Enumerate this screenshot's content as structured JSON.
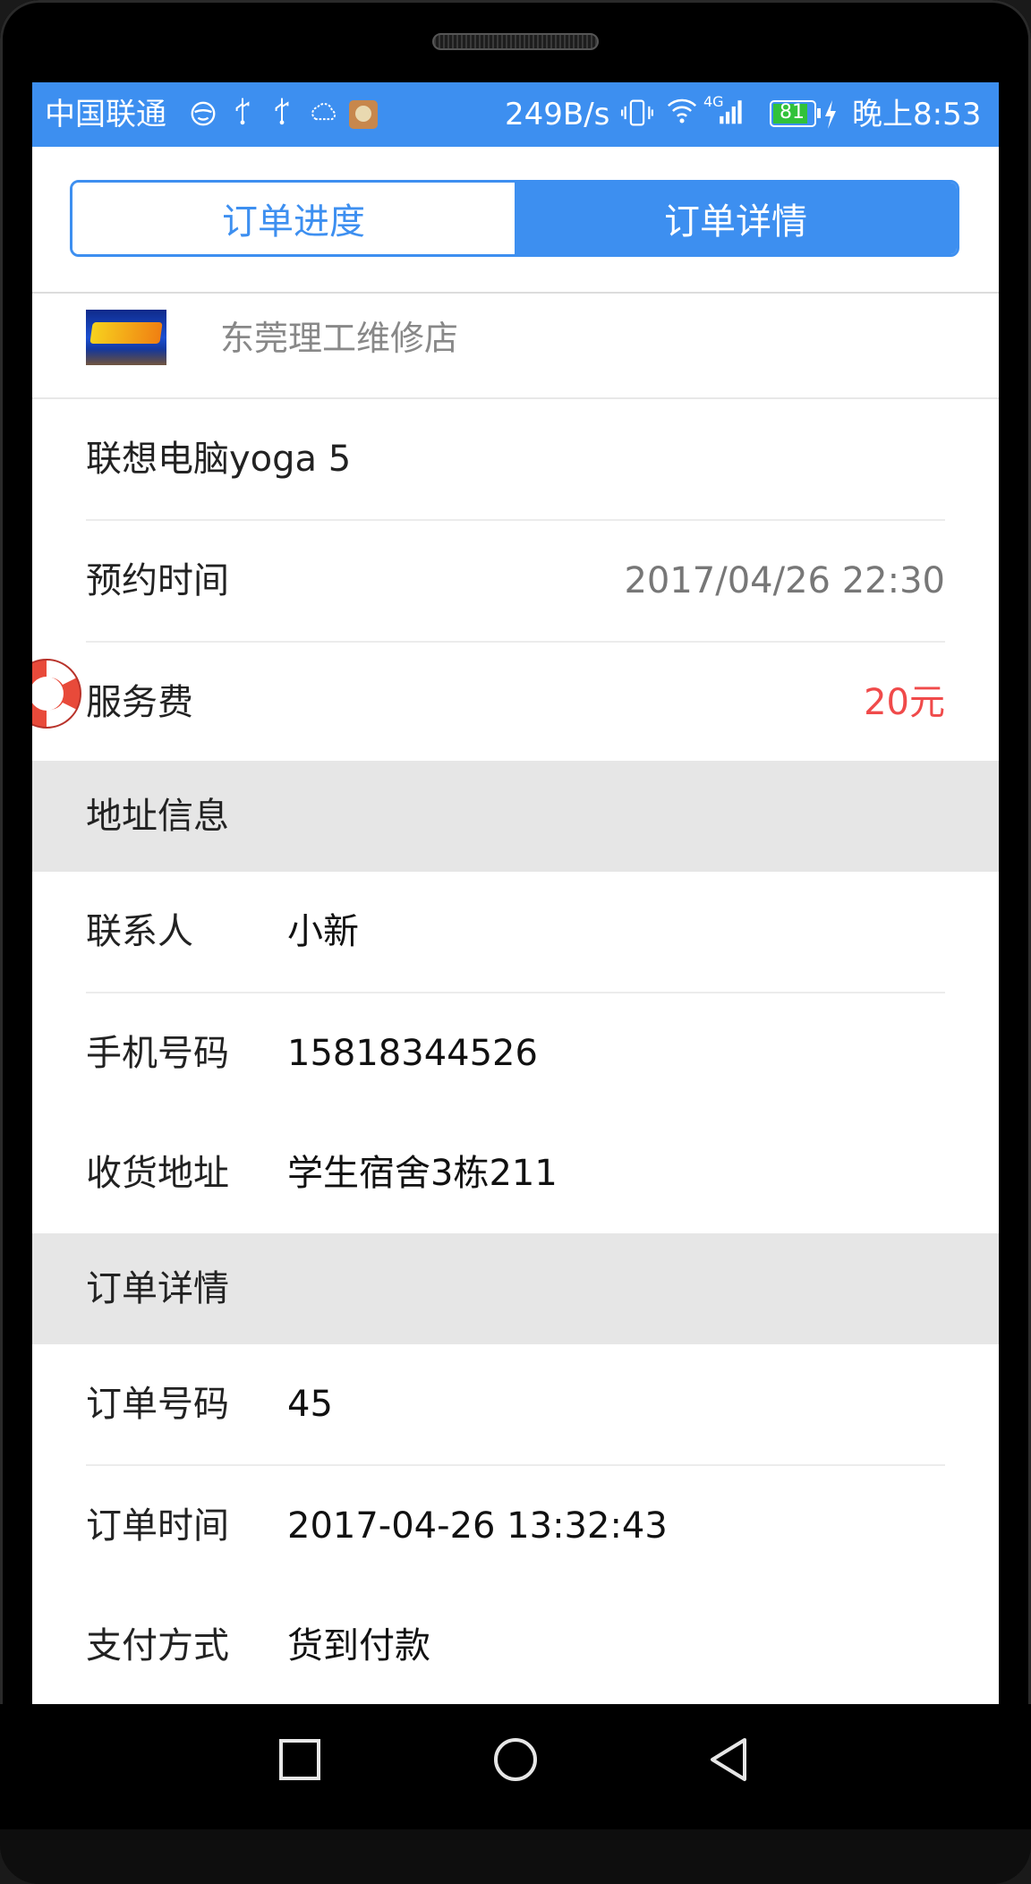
{
  "status_bar": {
    "carrier": "中国联通",
    "speed": "249B/s",
    "network": "4G",
    "battery": "81",
    "time": "晚上8:53"
  },
  "tabs": [
    {
      "label": "订单进度",
      "active": false
    },
    {
      "label": "订单详情",
      "active": true
    }
  ],
  "shop": {
    "name": "东莞理工维修店"
  },
  "item": {
    "name": "联想电脑yoga 5"
  },
  "appointment": {
    "label": "预约时间",
    "value": "2017/04/26 22:30"
  },
  "service_fee": {
    "label": "服务费",
    "value": "20元"
  },
  "address_section": {
    "title": "地址信息",
    "contact": {
      "label": "联系人",
      "value": "小新"
    },
    "phone": {
      "label": "手机号码",
      "value": "15818344526"
    },
    "address": {
      "label": "收货地址",
      "value": "学生宿舍3栋211"
    }
  },
  "order_section": {
    "title": "订单详情",
    "order_no": {
      "label": "订单号码",
      "value": "45"
    },
    "order_time": {
      "label": "订单时间",
      "value": "2017-04-26 13:32:43"
    },
    "payment": {
      "label": "支付方式",
      "value": "货到付款"
    }
  },
  "colors": {
    "accent": "#3d8ff0",
    "price": "#f04a4a",
    "section_bg": "#e6e6e6"
  },
  "icons": [
    "wifi-icon",
    "signal-icon",
    "battery-icon",
    "usb-icon",
    "lifebuoy-icon",
    "square-nav-icon",
    "circle-nav-icon",
    "back-nav-icon"
  ]
}
